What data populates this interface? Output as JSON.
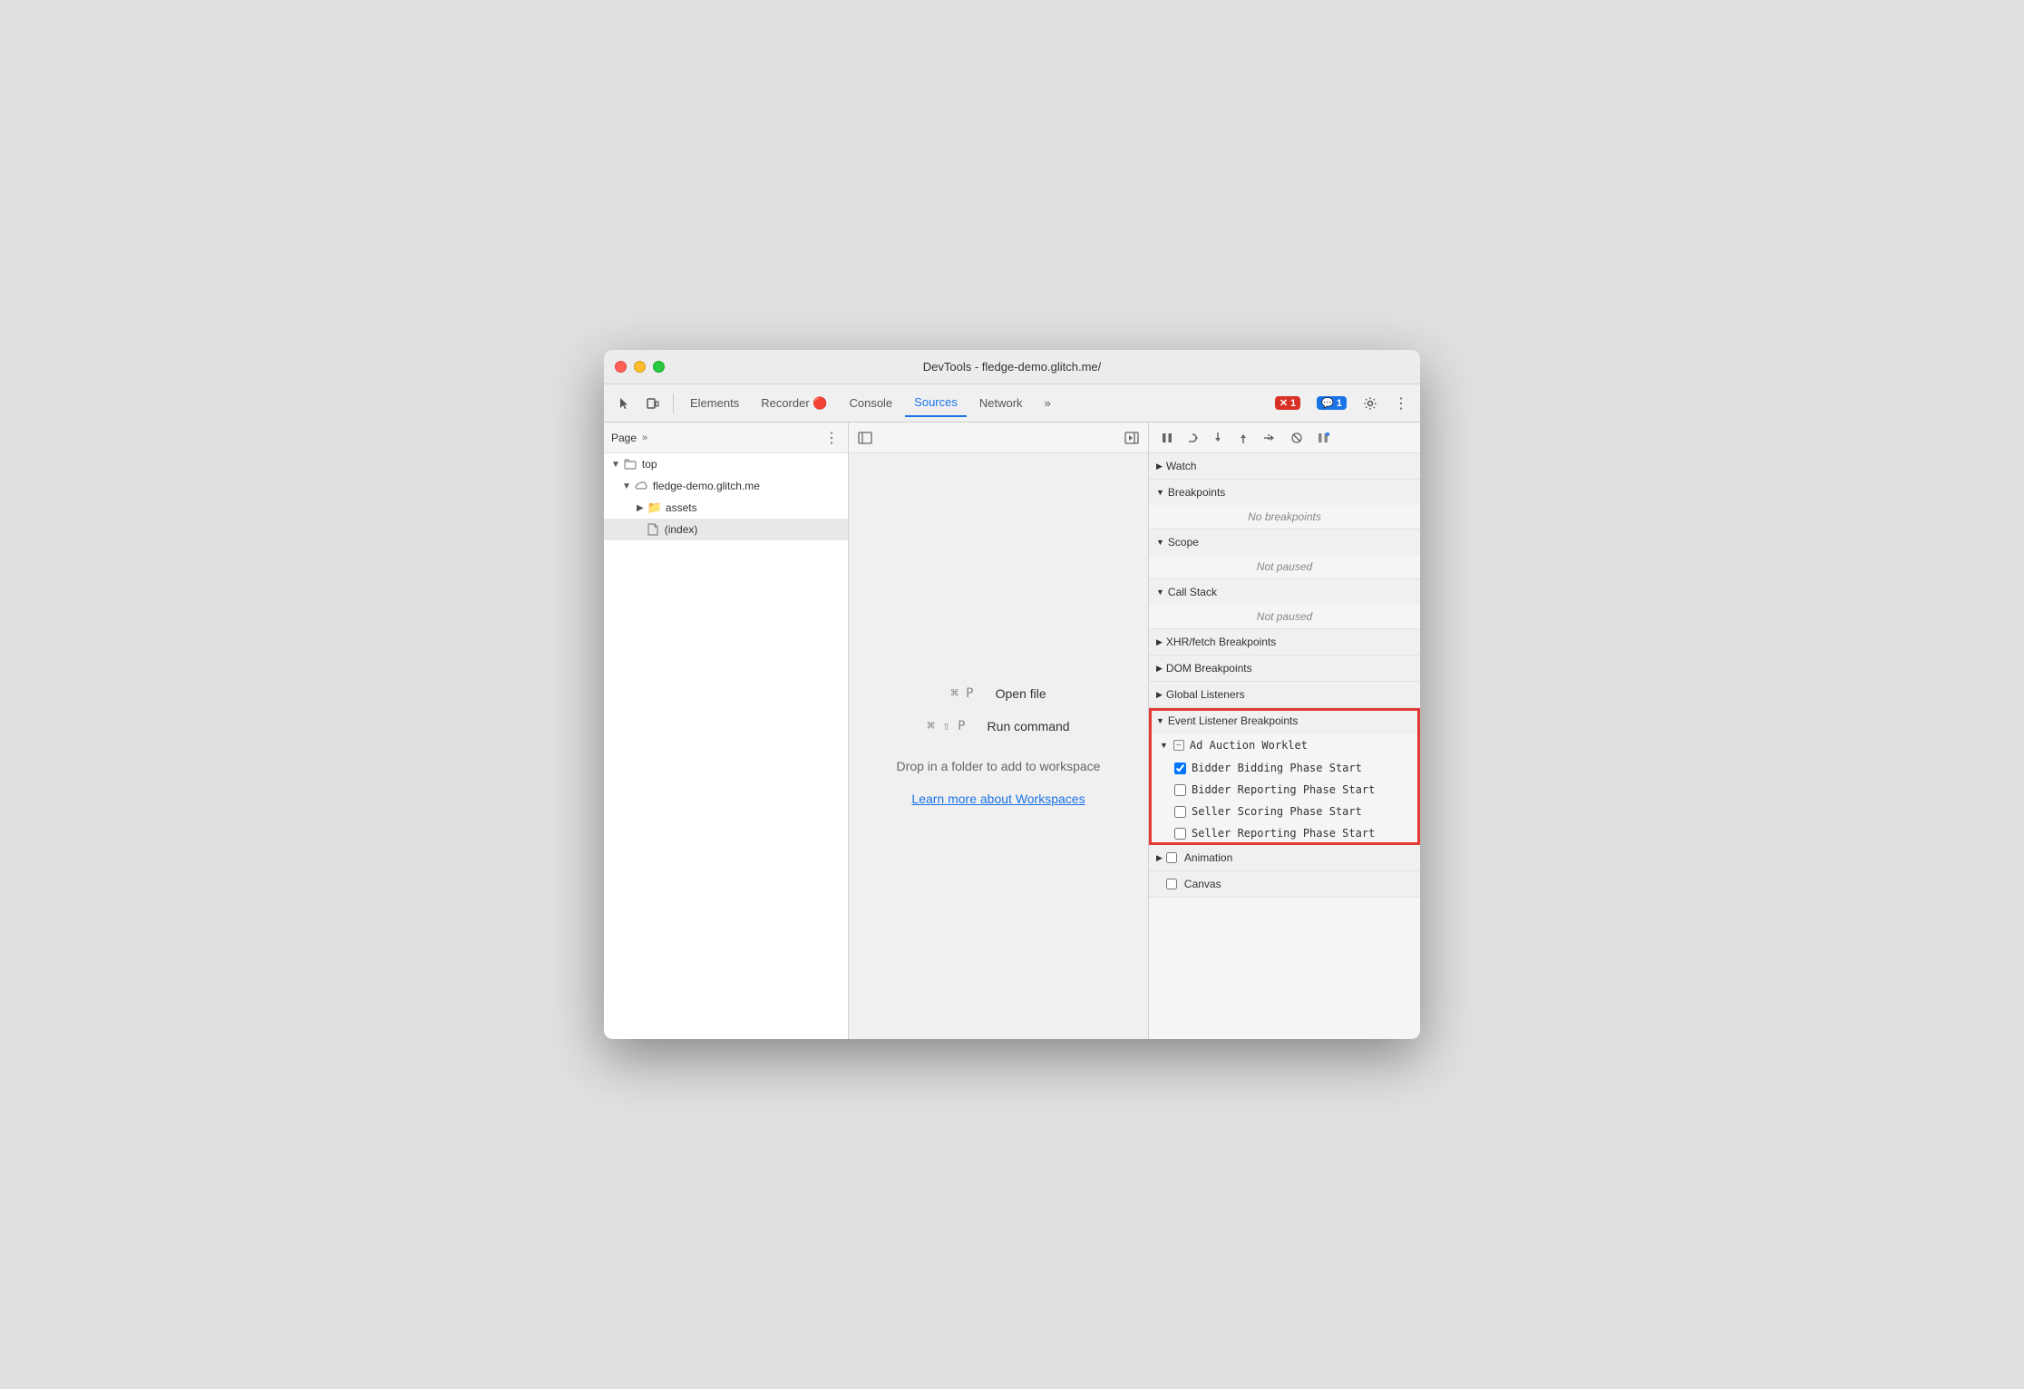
{
  "window": {
    "title": "DevTools - fledge-demo.glitch.me/"
  },
  "traffic_lights": {
    "red_label": "close",
    "yellow_label": "minimize",
    "green_label": "maximize"
  },
  "toolbar": {
    "tabs": [
      {
        "id": "elements",
        "label": "Elements",
        "active": false
      },
      {
        "id": "recorder",
        "label": "Recorder 🔴",
        "active": false
      },
      {
        "id": "console",
        "label": "Console",
        "active": false
      },
      {
        "id": "sources",
        "label": "Sources",
        "active": true
      },
      {
        "id": "network",
        "label": "Network",
        "active": false
      }
    ],
    "more_tabs_label": "»",
    "errors_count": "1",
    "messages_count": "1"
  },
  "left_panel": {
    "header_title": "Page",
    "more_label": "»",
    "tree": [
      {
        "id": "top",
        "label": "top",
        "indent": 0,
        "type": "expand",
        "icon": "folder"
      },
      {
        "id": "fledge-demo",
        "label": "fledge-demo.glitch.me",
        "indent": 1,
        "type": "expand",
        "icon": "cloud"
      },
      {
        "id": "assets",
        "label": "assets",
        "indent": 2,
        "type": "expand",
        "icon": "folder"
      },
      {
        "id": "index",
        "label": "(index)",
        "indent": 2,
        "type": "file",
        "icon": "file",
        "selected": true
      }
    ]
  },
  "center_panel": {
    "shortcuts": [
      {
        "keys": "⌘ P",
        "label": "Open file"
      },
      {
        "keys": "⌘ ⇧ P",
        "label": "Run command"
      }
    ],
    "drop_text": "Drop in a folder to add to workspace",
    "workspace_link": "Learn more about Workspaces"
  },
  "right_panel": {
    "debug_buttons": [
      {
        "id": "pause",
        "icon": "⏸",
        "label": "pause"
      },
      {
        "id": "step-over",
        "icon": "↪",
        "label": "step-over"
      },
      {
        "id": "step-into",
        "icon": "↓",
        "label": "step-into"
      },
      {
        "id": "step-out",
        "icon": "↑",
        "label": "step-out"
      },
      {
        "id": "step",
        "icon": "→",
        "label": "step"
      },
      {
        "id": "deactivate",
        "icon": "🚫",
        "label": "deactivate-breakpoints"
      },
      {
        "id": "pause-exceptions",
        "icon": "⏸",
        "label": "pause-on-exceptions"
      }
    ],
    "sections": [
      {
        "id": "watch",
        "label": "Watch",
        "collapsed": true,
        "content": null
      },
      {
        "id": "breakpoints",
        "label": "Breakpoints",
        "collapsed": false,
        "content": "No breakpoints",
        "content_italic": true
      },
      {
        "id": "scope",
        "label": "Scope",
        "collapsed": false,
        "content": "Not paused",
        "content_italic": true
      },
      {
        "id": "call-stack",
        "label": "Call Stack",
        "collapsed": false,
        "content": "Not paused",
        "content_italic": true
      },
      {
        "id": "xhr-fetch",
        "label": "XHR/fetch Breakpoints",
        "collapsed": true,
        "content": null
      },
      {
        "id": "dom",
        "label": "DOM Breakpoints",
        "collapsed": true,
        "content": null
      },
      {
        "id": "global-listeners",
        "label": "Global Listeners",
        "collapsed": true,
        "content": null
      },
      {
        "id": "event-listener-breakpoints",
        "label": "Event Listener Breakpoints",
        "collapsed": false,
        "highlighted": true,
        "sub_sections": [
          {
            "id": "ad-auction-worklet",
            "label": "Ad Auction Worklet",
            "expanded": true,
            "items": [
              {
                "id": "bidder-bidding",
                "label": "Bidder Bidding Phase Start",
                "checked": true
              },
              {
                "id": "bidder-reporting",
                "label": "Bidder Reporting Phase Start",
                "checked": false
              },
              {
                "id": "seller-scoring",
                "label": "Seller Scoring Phase Start",
                "checked": false
              },
              {
                "id": "seller-reporting",
                "label": "Seller Reporting Phase Start",
                "checked": false
              }
            ]
          }
        ]
      },
      {
        "id": "animation",
        "label": "Animation",
        "collapsed": true,
        "has_checkbox": true,
        "content": null
      },
      {
        "id": "canvas",
        "label": "Canvas",
        "collapsed": true,
        "has_checkbox": true,
        "content": null
      }
    ]
  }
}
